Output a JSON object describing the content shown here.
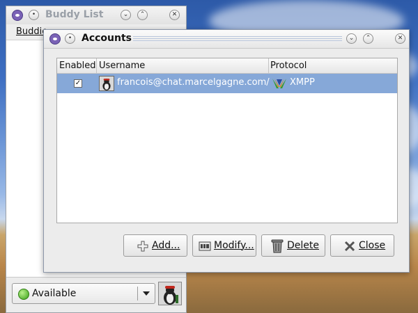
{
  "buddy_list": {
    "title": "Buddy List",
    "menu_label": "Buddie",
    "status": {
      "label": "Available",
      "color": "#3aa018"
    }
  },
  "accounts_dialog": {
    "title": "Accounts",
    "columns": {
      "enabled": "Enabled",
      "username": "Username",
      "protocol": "Protocol"
    },
    "rows": [
      {
        "enabled": true,
        "username": "francois@chat.marcelgagne.com/",
        "protocol": "XMPP"
      }
    ],
    "buttons": {
      "add": "Add...",
      "modify": "Modify...",
      "delete": "Delete",
      "close": "Close"
    },
    "selection_color": "#86a8d8"
  }
}
